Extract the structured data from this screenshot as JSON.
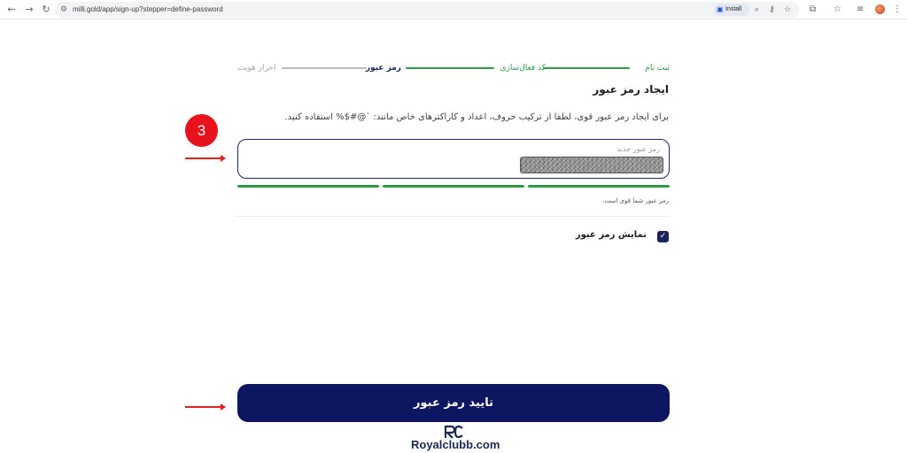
{
  "browser": {
    "url": "milli.gold/app/sign-up?stepper=define-password",
    "install_label": "Install"
  },
  "stepper": {
    "steps": [
      {
        "label": "ثبت نام",
        "state": "done"
      },
      {
        "label": "کد فعال‌سازی",
        "state": "done"
      },
      {
        "label": "رمز عبور",
        "state": "current"
      },
      {
        "label": "احراز هویت",
        "state": "pending"
      }
    ],
    "colors": {
      "done": "#2e9a47",
      "current": "#1a2360",
      "pending": "#b9bdc6"
    }
  },
  "form": {
    "title": "ایجاد رمز عبور",
    "description": "برای ایجاد رمز عبور قوی، لطفا از ترکیب حروف، اعداد و کاراکترهای خاص مانند: `@#$% استفاده کنید.",
    "password_placeholder": "رمز عبور جدید",
    "strength_text": "رمز عبور شما قوی است.",
    "strength_level": 3,
    "strength_max": 3,
    "show_password_label": "نمایش رمز عبور",
    "show_password_checked": true,
    "submit_label": "تایید رمز عبور"
  },
  "annotation": {
    "step_number": "3"
  },
  "watermark": {
    "logo": "RC",
    "text": "Royalclubb.com"
  },
  "colors": {
    "primary": "#0d1660",
    "success": "#2e9a47",
    "annotation": "#e8121c"
  }
}
